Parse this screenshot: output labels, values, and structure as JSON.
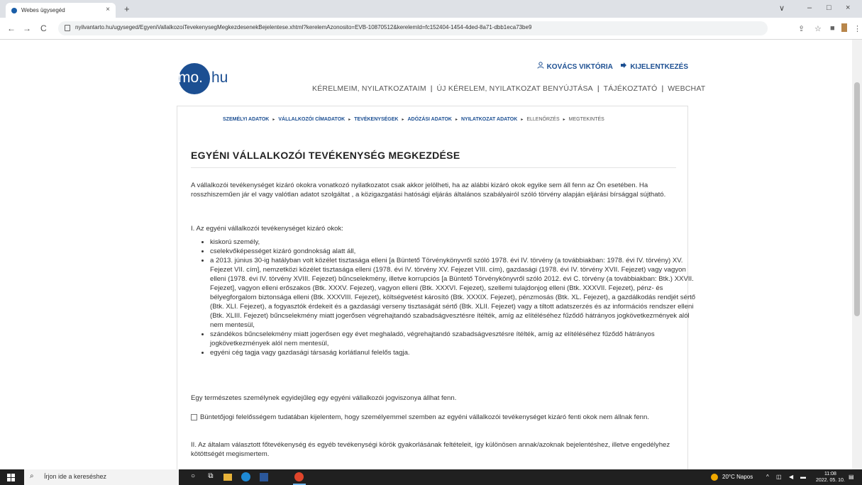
{
  "browser": {
    "tab_title": "Webes ügysegéd",
    "tab_close": "×",
    "new_tab": "+",
    "url": "nyilvantarto.hu/ugyseged/EgyeniVallalkozoiTevekenysegMegkezdesenekBejelentese.xhtml?kerelemAzonosito=EVB-10870512&kerelemId=fc152404-1454-4ded-8a71-dbb1eca73be9",
    "back": "←",
    "forward": "→",
    "reload": "C",
    "win_menu": "∨",
    "win_min": "–",
    "win_max": "□",
    "win_close": "×",
    "share": "⇪",
    "star": "☆",
    "sidepanel": "■",
    "menu": "⋮"
  },
  "header": {
    "logo_mo": "mo.",
    "logo_hu": "hu",
    "user_name": "KOVÁCS VIKTÓRIA",
    "logout": "KIJELENTKEZÉS",
    "nav": [
      "KÉRELMEIM, NYILATKOZATAIM",
      "ÚJ KÉRELEM, NYILATKOZAT BENYÚJTÁSA",
      "TÁJÉKOZTATÓ",
      "WEBCHAT"
    ],
    "nav_sep": "|"
  },
  "steps": {
    "items": [
      "SZEMÉLYI ADATOK",
      "VÁLLALKOZÓI CÍMADATOK",
      "TEVÉKENYSÉGEK",
      "ADÓZÁSI ADATOK",
      "NYILATKOZAT ADATOK",
      "ELLENŐRZÉS",
      "MEGTEKINTÉS"
    ],
    "arrow": "▸"
  },
  "main": {
    "title": "EGYÉNI VÁLLALKOZÓI TEVÉKENYSÉG MEGKEZDÉSE",
    "intro": "A vállalkozói tevékenységet kizáró okokra vonatkozó nyilatkozatot csak akkor jelölheti, ha az alábbi kizáró okok egyike sem áll fenn az Ön esetében. Ha rosszhiszeműen jár el vagy valótlan adatot szolgáltat , a közigazgatási hatósági eljárás általános szabályairól szóló törvény alapján eljárási bírsággal sújtható.",
    "section1": "I. Az egyéni vállalkozói tevékenységet kizáró okok:",
    "bullets": [
      "kiskorú személy,",
      "cselekvőképességet kizáró gondnokság alatt áll,",
      "a 2013. június 30-ig hatályban volt közélet tisztasága elleni [a Büntető Törvénykönyvről szóló 1978. évi IV. törvény (a továbbiakban: 1978. évi IV. törvény) XV. Fejezet VII. cím], nemzetközi közélet tisztasága elleni (1978. évi IV. törvény XV. Fejezet VIII. cím), gazdasági (1978. évi IV. törvény XVII. Fejezet) vagy vagyon elleni (1978. évi IV. törvény XVIII. Fejezet) bűncselekmény, illetve korrupciós [a Büntető Törvénykönyvről szóló 2012. évi C. törvény (a továbbiakban: Btk.) XXVII. Fejezet], vagyon elleni erőszakos (Btk. XXXV. Fejezet), vagyon elleni (Btk. XXXVI. Fejezet), szellemi tulajdonjog elleni (Btk. XXXVII. Fejezet), pénz- és bélyegforgalom biztonsága elleni (Btk. XXXVIII. Fejezet), költségvetést károsító (Btk. XXXIX. Fejezet), pénzmosás (Btk. XL. Fejezet), a gazdálkodás rendjét sértő (Btk. XLI. Fejezet), a fogyasztók érdekeit és a gazdasági verseny tisztaságát sértő (Btk. XLII. Fejezet) vagy a tiltott adatszerzés és az információs rendszer elleni (Btk. XLIII. Fejezet) bűncselekmény miatt jogerősen végrehajtandó szabadságvesztésre ítélték, amíg az elítéléséhez fűződő hátrányos jogkövetkezmények alól nem mentesül,",
      "szándékos bűncselekmény miatt jogerősen egy évet meghaladó, végrehajtandó szabadságvesztésre ítélték, amíg az elítéléséhez fűződő hátrányos jogkövetkezmények alól nem mentesül,",
      "egyéni cég tagja vagy gazdasági társaság korlátlanul felelős tagja."
    ],
    "one_relationship": "Egy természetes személynek egyidejűleg egy egyéni vállalkozói jogviszonya állhat fenn.",
    "declaration1": "Büntetőjogi felelősségem tudatában kijelentem, hogy személyemmel szemben az egyéni vállalkozói tevékenységet kizáró fenti okok nem állnak fenn.",
    "section2": "II. Az általam választott főtevékenység és egyéb tevékenységi körök gyakorlásának feltételeit, így különösen annak/azoknak bejelentéshez, illetve engedélyhez kötöttségét megismertem."
  },
  "taskbar": {
    "search_placeholder": "Írjon ide a kereséshez",
    "weather": "20°C  Napos",
    "time": "11:08",
    "date": "2022. 05. 10."
  },
  "colors": {
    "brand": "#1c4f92",
    "link": "#1c4f92",
    "taskbar": "#202020"
  }
}
